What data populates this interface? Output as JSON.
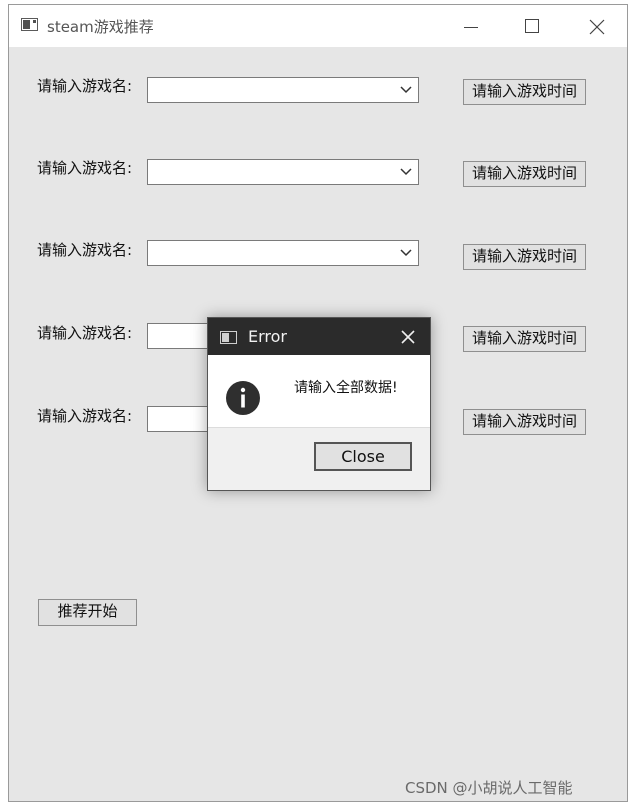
{
  "window": {
    "title": "steam游戏推荐",
    "controls": {
      "minimize_icon": "minimize-icon",
      "maximize_icon": "maximize-icon",
      "close_icon": "close-icon"
    }
  },
  "form": {
    "rows": [
      {
        "label": "请输入游戏名:",
        "value": "",
        "button_label": "请输入游戏时间"
      },
      {
        "label": "请输入游戏名:",
        "value": "",
        "button_label": "请输入游戏时间"
      },
      {
        "label": "请输入游戏名:",
        "value": "",
        "button_label": "请输入游戏时间"
      },
      {
        "label": "请输入游戏名:",
        "value": "",
        "button_label": "请输入游戏时间"
      },
      {
        "label": "请输入游戏名:",
        "value": "",
        "button_label": "请输入游戏时间"
      }
    ],
    "start_button_label": "推荐开始"
  },
  "dialog": {
    "title": "Error",
    "message": "请输入全部数据!",
    "close_button_label": "Close",
    "icon": "info-icon"
  },
  "watermark": "CSDN @小胡说人工智能",
  "colors": {
    "window_bg": "#e6e6e6",
    "dialog_titlebar": "#2b2b2b"
  }
}
